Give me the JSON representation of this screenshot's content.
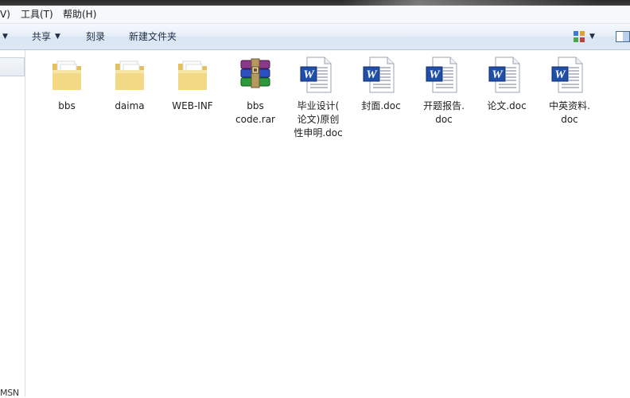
{
  "menubar": {
    "items": [
      {
        "label": "V)"
      },
      {
        "label": "工具(T)"
      },
      {
        "label": "帮助(H)"
      }
    ]
  },
  "toolbar": {
    "share_label": "共享",
    "burn_label": "刻录",
    "new_folder_label": "新建文件夹"
  },
  "sidebar": {
    "partial_label": "MSN"
  },
  "files": [
    {
      "name": "bbs",
      "type": "folder"
    },
    {
      "name": "daima",
      "type": "folder"
    },
    {
      "name": "WEB-INF",
      "type": "folder"
    },
    {
      "name": "bbs\ncode.rar",
      "type": "rar"
    },
    {
      "name": "毕业设计(\n论文)原创\n性申明.doc",
      "type": "word"
    },
    {
      "name": "封面.doc",
      "type": "word"
    },
    {
      "name": "开题报告.\ndoc",
      "type": "word"
    },
    {
      "name": "论文.doc",
      "type": "word"
    },
    {
      "name": "中英资料.\ndoc",
      "type": "word"
    }
  ],
  "colors": {
    "toolbar_top": "#f5f9fd",
    "toolbar_bottom": "#dde8f5",
    "folder": "#f3d985",
    "word_blue": "#1f4fa8"
  }
}
